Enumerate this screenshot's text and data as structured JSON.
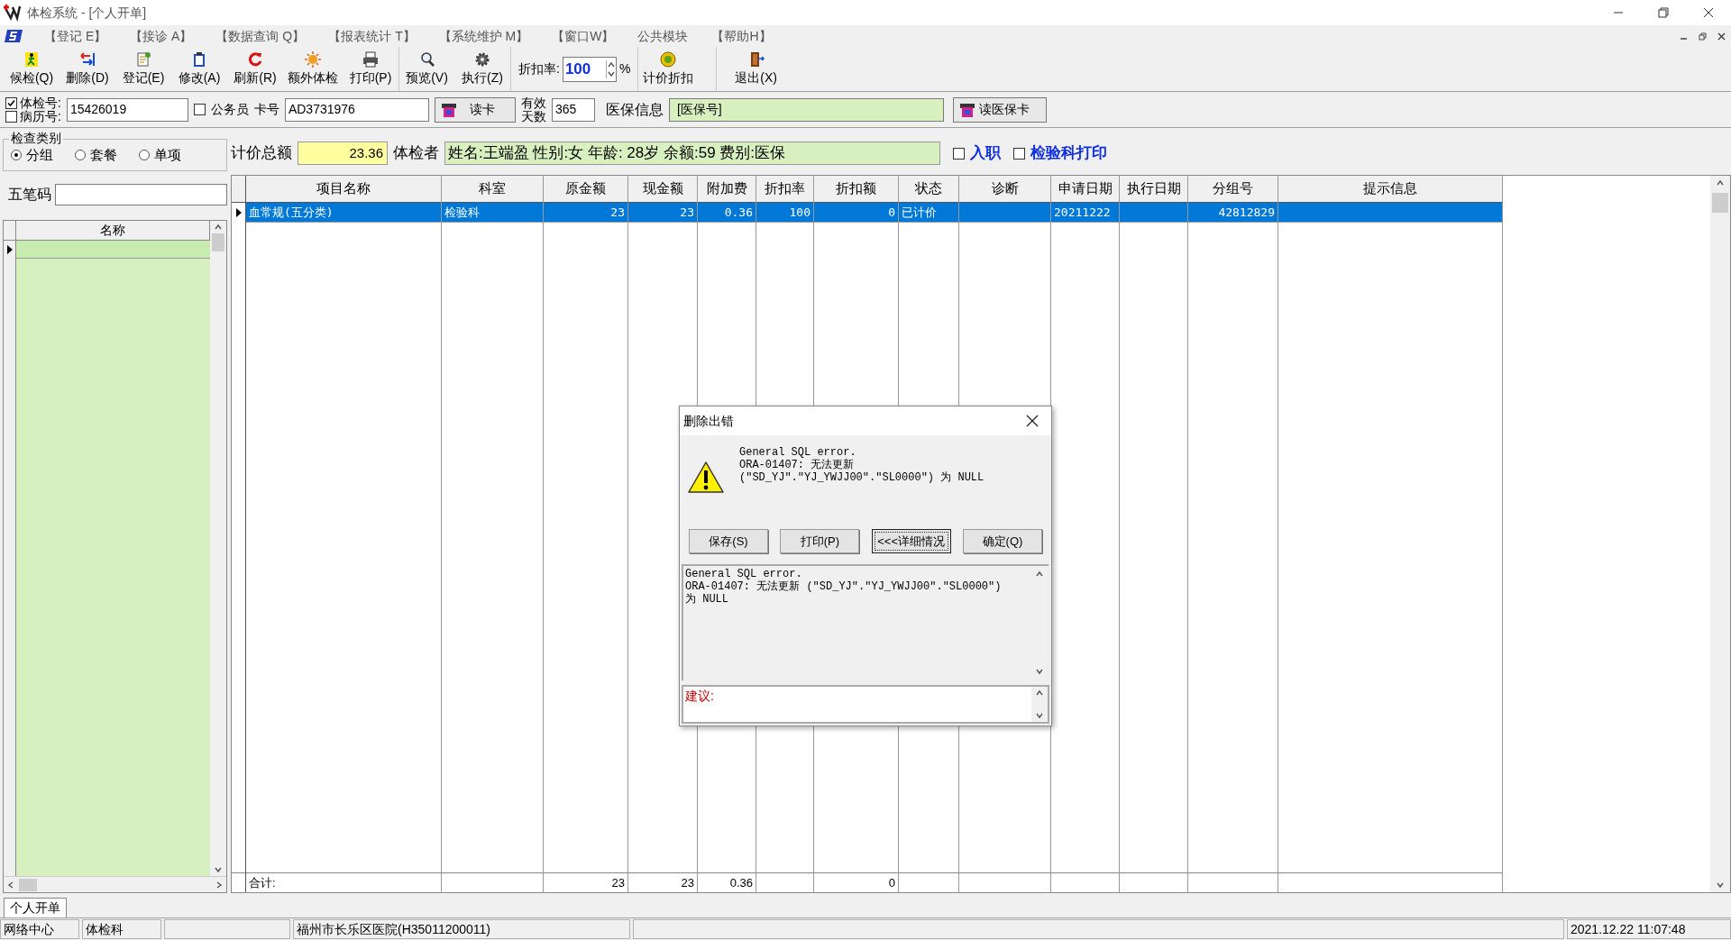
{
  "window": {
    "title": "体检系统 - [个人开单]"
  },
  "menu": [
    "【登记 E】",
    "【接诊 A】",
    "【数据查询 Q】",
    "【报表统计 T】",
    "【系统维护 M】",
    "【窗口W】",
    "公共模块",
    "【帮助H】"
  ],
  "toolbar": [
    {
      "kind": "button",
      "label": "候检(Q)"
    },
    {
      "kind": "button",
      "label": "删除(D)"
    },
    {
      "kind": "button",
      "label": "登记(E)"
    },
    {
      "kind": "button",
      "label": "修改(A)"
    },
    {
      "kind": "button",
      "label": "刷新(R)"
    },
    {
      "kind": "button",
      "label": "额外体检"
    },
    {
      "kind": "button",
      "label": "打印(P)"
    },
    {
      "kind": "button",
      "label": "预览(V)"
    },
    {
      "kind": "button",
      "label": "执行(Z)"
    },
    {
      "kind": "spinner",
      "label": "折扣率:",
      "value": "100",
      "unit": "%"
    },
    {
      "kind": "button",
      "label": "计价折扣"
    },
    {
      "kind": "button",
      "label": "退出(X)"
    }
  ],
  "id_row": {
    "exam_no": {
      "label": "体检号:",
      "checked": true
    },
    "record_no": {
      "label": "病历号:",
      "checked": false
    },
    "id_value": "15426019",
    "civil_servant": {
      "label": "公务员",
      "checked": false
    },
    "card_label": "卡号",
    "card_value": "AD3731976",
    "read_card": "读卡",
    "valid_days_label": [
      "有效",
      "天数"
    ],
    "valid_days": "365",
    "insurance_label": "医保信息",
    "insurance_value": "[医保号]",
    "read_insurance": "读医保卡"
  },
  "exam_type": {
    "title": "检查类别",
    "options": [
      {
        "label": "分组",
        "selected": true
      },
      {
        "label": "套餐",
        "selected": false
      },
      {
        "label": "单项",
        "selected": false
      }
    ]
  },
  "wubi": {
    "label": "五笔码"
  },
  "name_list": {
    "header": "名称",
    "rows": [
      {
        "selected": true
      }
    ]
  },
  "summary": {
    "total_label": "计价总额",
    "total_value": "23.36",
    "examinee_label": "体检者",
    "examinee_value": "姓名:王端盈 性别:女 年龄: 28岁 余额:59 费别:医保",
    "checks": [
      {
        "label": "入职",
        "checked": false
      },
      {
        "label": "检验科打印",
        "checked": false
      }
    ]
  },
  "table": {
    "columns": [
      {
        "title": "项目名称",
        "kind": "text",
        "total": "合计:"
      },
      {
        "title": "科室",
        "kind": "text"
      },
      {
        "title": "原金额",
        "kind": "number",
        "total": "23"
      },
      {
        "title": "现金额",
        "kind": "number",
        "total": "23"
      },
      {
        "title": "附加费",
        "kind": "number",
        "total": "0.36"
      },
      {
        "title": "折扣率",
        "kind": "number"
      },
      {
        "title": "折扣额",
        "kind": "number",
        "total": "0"
      },
      {
        "title": "状态",
        "kind": "text"
      },
      {
        "title": "诊断",
        "kind": "text"
      },
      {
        "title": "申请日期",
        "kind": "text"
      },
      {
        "title": "执行日期",
        "kind": "text"
      },
      {
        "title": "分组号",
        "kind": "number"
      },
      {
        "title": "提示信息",
        "kind": "text"
      }
    ],
    "rows": [
      {
        "selected": true,
        "cells": [
          "血常规(五分类)",
          "检验科",
          "23",
          "23",
          "0.36",
          "100",
          "0",
          "已计价",
          null,
          "20211222",
          null,
          "42812829",
          null
        ]
      }
    ]
  },
  "dialog": {
    "title": "删除出错",
    "message": [
      "General SQL error.",
      "ORA-01407: 无法更新",
      "(\"SD_YJ\".\"YJ_YWJJ00\".\"SL0000\") 为 NULL"
    ],
    "buttons": [
      {
        "label": "保存(S)",
        "focused": false
      },
      {
        "label": "打印(P)",
        "focused": false
      },
      {
        "label": "<<<详细情况",
        "focused": true
      },
      {
        "label": "确定(Q)",
        "focused": false
      }
    ],
    "details": [
      "General SQL error.",
      "ORA-01407: 无法更新 (\"SD_YJ\".\"YJ_YWJJ00\".\"SL0000\")",
      "为 NULL"
    ],
    "suggestion_label": "建议:"
  },
  "tabs": [
    {
      "label": "个人开单",
      "selected": true
    }
  ],
  "status_bar": {
    "left": [
      "网络中心",
      "体检科"
    ],
    "hospital": "福州市长乐区医院(H35011200011)",
    "time": "2021.12.22 11:07:48"
  }
}
